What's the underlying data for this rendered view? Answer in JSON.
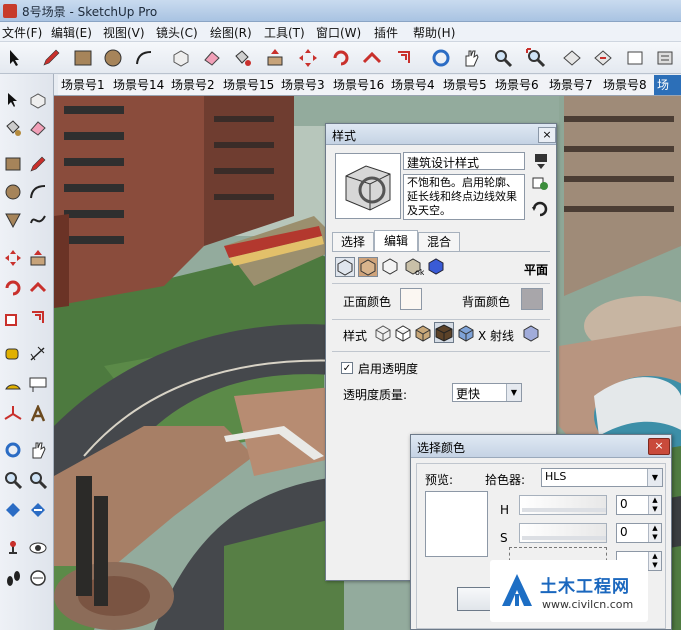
{
  "window": {
    "title": "8号场景 - SketchUp Pro"
  },
  "menu": [
    "文件(F)",
    "编辑(E)",
    "视图(V)",
    "镜头(C)",
    "绘图(R)",
    "工具(T)",
    "窗口(W)",
    "插件",
    "帮助(H)"
  ],
  "toolbar_icons": [
    "select-icon",
    "pencil-icon",
    "rectangle-icon",
    "circle-icon",
    "arc-icon",
    "make-component-icon",
    "eraser-icon",
    "paint-bucket-icon",
    "push-pull-icon",
    "move-icon",
    "rotate-icon",
    "follow-me-icon",
    "offset-icon",
    "orbit-icon",
    "pan-icon",
    "zoom-icon",
    "zoom-extents-icon",
    "previous-view-icon",
    "next-view-icon",
    "next-view-icon"
  ],
  "scene_tabs": [
    "场景号1",
    "场景号14",
    "场景号2",
    "场景号15",
    "场景号3",
    "场景号16",
    "场景号4",
    "场景号5",
    "场景号6",
    "场景号7",
    "场景号8",
    "场"
  ],
  "active_scene_tab": 11,
  "styles_panel": {
    "title": "样式",
    "close": "×",
    "style_name": "建筑设计样式",
    "description": "不饱和色。启用轮廓、延长线和终点边线效果及天空。",
    "tabs": [
      "选择",
      "编辑",
      "混合"
    ],
    "active_tab": 1,
    "mode_label": "平面",
    "front_color_label": "正面颜色",
    "back_color_label": "背面颜色",
    "style_label": "样式",
    "xray_label": "X 射线",
    "transparency_label": "启用透明度",
    "transparency_checked": true,
    "quality_label": "透明度质量:",
    "quality_value": "更快"
  },
  "color_dialog": {
    "title": "选择颜色",
    "close": "×",
    "preview_label": "预览:",
    "picker_label": "拾色器:",
    "picker_value": "HLS",
    "h_label": "H",
    "h_value": "0",
    "s_label": "S",
    "s_value": "0",
    "ok_label": "确"
  },
  "watermark": {
    "text": "土木工程网",
    "url": "www.civilcn.com"
  },
  "colors": {
    "front_color": "#fbf7f2",
    "back_color": "#a8a6aa",
    "title_bar": "#b7cde8",
    "active_tab": "#2c6fb8"
  }
}
